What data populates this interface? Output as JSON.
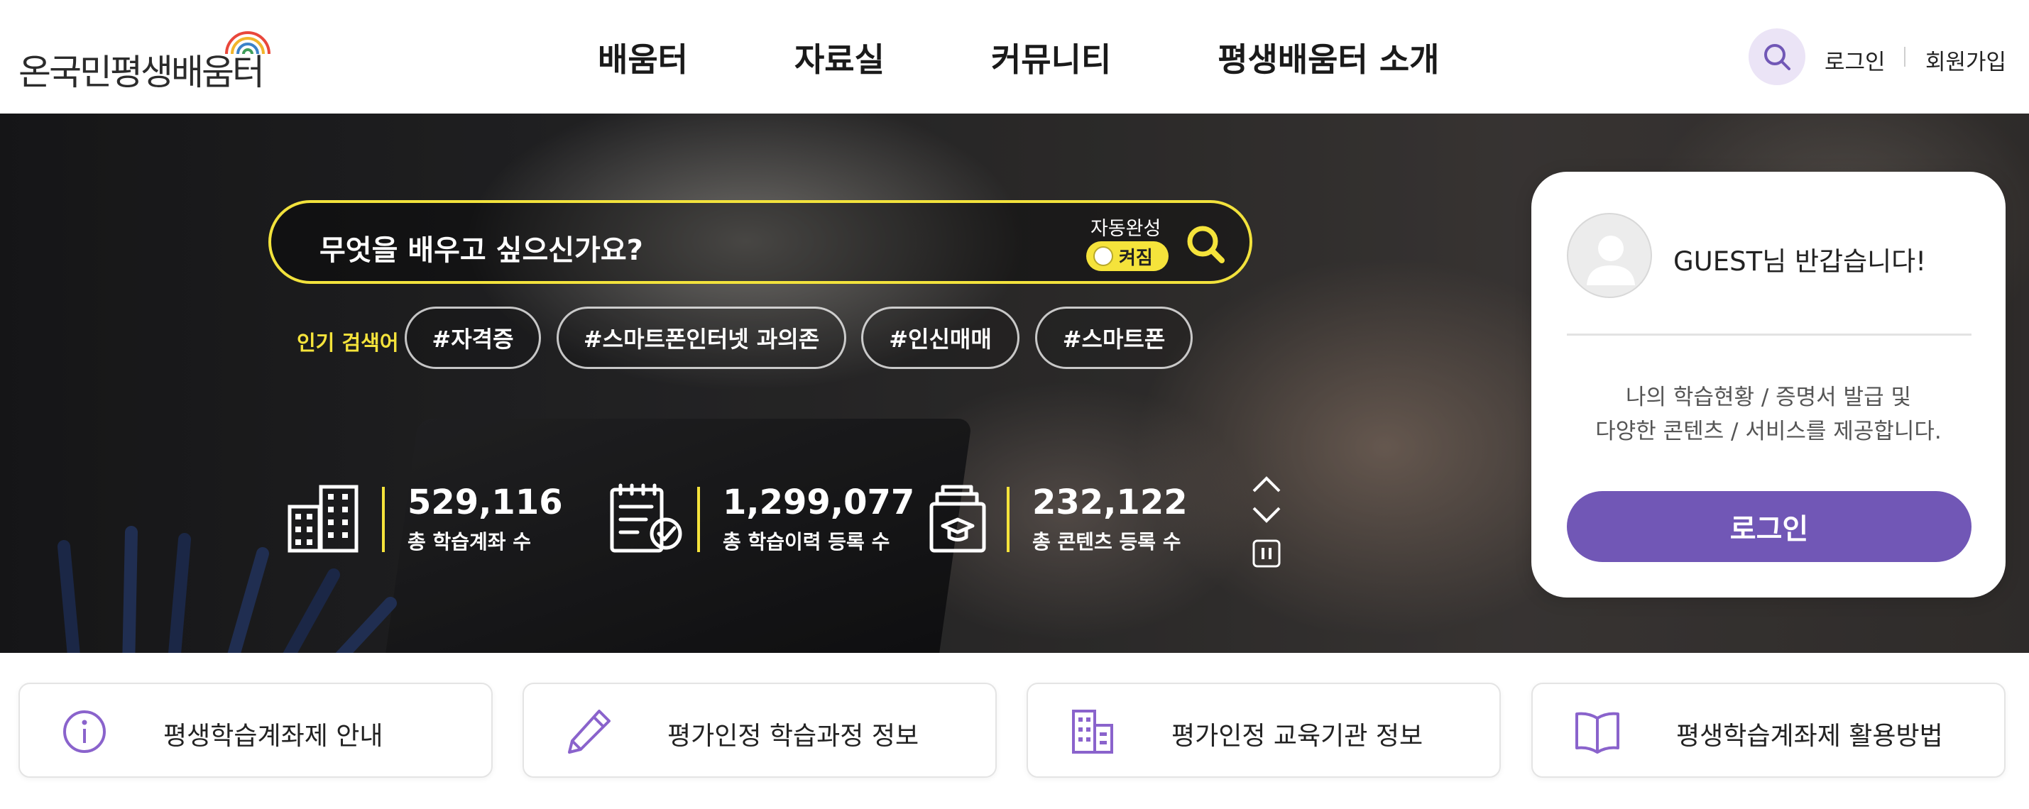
{
  "header": {
    "logo_text": "온국민평생배움터",
    "nav": [
      "배움터",
      "자료실",
      "커뮤니티",
      "평생배움터 소개"
    ],
    "login_label": "로그인",
    "signup_label": "회원가입"
  },
  "hero": {
    "search_placeholder": "무엇을 배우고 싶으신가요?",
    "autocomplete_label": "자동완성",
    "autocomplete_state": "켜짐",
    "popular_label": "인기 검색어",
    "tags": [
      "#자격증",
      "#스마트폰인터넷 과의존",
      "#인신매매",
      "#스마트폰"
    ],
    "stats": [
      {
        "icon": "building-icon",
        "value": "529,116",
        "label": "총 학습계좌 수"
      },
      {
        "icon": "checklist-icon",
        "value": "1,299,077",
        "label": "총 학습이력 등록 수"
      },
      {
        "icon": "graduation-folder-icon",
        "value": "232,122",
        "label": "총 콘텐츠 등록 수"
      }
    ]
  },
  "login_card": {
    "greeting": "GUEST님 반갑습니다!",
    "desc_line1": "나의 학습현황 / 증명서 발급 및",
    "desc_line2": "다양한 콘텐츠 / 서비스를 제공합니다.",
    "button": "로그인"
  },
  "quick_links": [
    {
      "icon": "info-icon",
      "label": "평생학습계좌제 안내"
    },
    {
      "icon": "pencil-icon",
      "label": "평가인정 학습과정 정보"
    },
    {
      "icon": "institution-icon",
      "label": "평가인정 교육기관 정보"
    },
    {
      "icon": "book-icon",
      "label": "평생학습계좌제 활용방법"
    }
  ],
  "colors": {
    "accent_purple": "#7157b6",
    "accent_yellow": "#f5e33b",
    "icon_purple": "#8a63cc"
  }
}
